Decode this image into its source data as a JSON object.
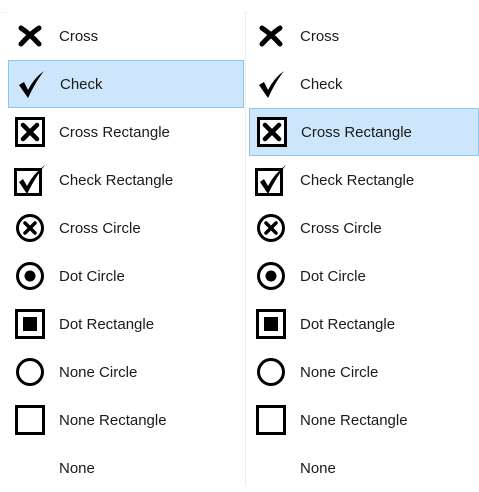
{
  "left_list": {
    "selected_index": 1,
    "items": [
      {
        "label": "Cross",
        "icon": "cross-icon"
      },
      {
        "label": "Check",
        "icon": "check-icon"
      },
      {
        "label": "Cross Rectangle",
        "icon": "cross-rectangle-icon"
      },
      {
        "label": "Check Rectangle",
        "icon": "check-rectangle-icon"
      },
      {
        "label": "Cross Circle",
        "icon": "cross-circle-icon"
      },
      {
        "label": "Dot Circle",
        "icon": "dot-circle-icon"
      },
      {
        "label": "Dot Rectangle",
        "icon": "dot-rectangle-icon"
      },
      {
        "label": "None Circle",
        "icon": "none-circle-icon"
      },
      {
        "label": "None Rectangle",
        "icon": "none-rectangle-icon"
      },
      {
        "label": "None",
        "icon": ""
      }
    ]
  },
  "right_list": {
    "selected_index": 2,
    "items": [
      {
        "label": "Cross",
        "icon": "cross-icon"
      },
      {
        "label": "Check",
        "icon": "check-icon"
      },
      {
        "label": "Cross Rectangle",
        "icon": "cross-rectangle-icon"
      },
      {
        "label": "Check Rectangle",
        "icon": "check-rectangle-icon"
      },
      {
        "label": "Cross Circle",
        "icon": "cross-circle-icon"
      },
      {
        "label": "Dot Circle",
        "icon": "dot-circle-icon"
      },
      {
        "label": "Dot Rectangle",
        "icon": "dot-rectangle-icon"
      },
      {
        "label": "None Circle",
        "icon": "none-circle-icon"
      },
      {
        "label": "None Rectangle",
        "icon": "none-rectangle-icon"
      },
      {
        "label": "None",
        "icon": ""
      }
    ]
  },
  "colors": {
    "selection_fill": "#cde6fb",
    "selection_border": "#8fc4ef",
    "icon": "#000000",
    "text": "#1a1a1a"
  }
}
